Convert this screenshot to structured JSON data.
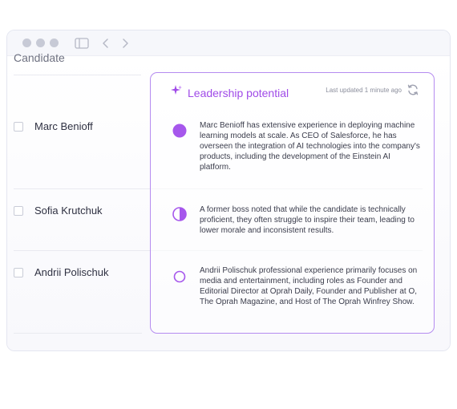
{
  "window": {
    "controls": [
      "nav-back",
      "nav-forward"
    ]
  },
  "table": {
    "column_header": "Candidate"
  },
  "panel": {
    "title": "Leadership potential",
    "updated": "Last updated 1 minute ago",
    "accent_color": "#a04be8",
    "border_color": "#b58cf0"
  },
  "candidates": [
    {
      "name": "Marc Benioff",
      "potential": "full",
      "potential_level": 1.0,
      "description": "Marc Benioff has extensive experience in deploying machine learning models at scale. As CEO of Salesforce, he has overseen the integration of AI technologies into the company's products, including the development of the Einstein AI platform."
    },
    {
      "name": "Sofia Krutchuk",
      "potential": "half",
      "potential_level": 0.5,
      "description": "A former boss noted that while the candidate is technically proficient, they often struggle to inspire their team, leading to lower morale and inconsistent results."
    },
    {
      "name": "Andrii Polischuk",
      "potential": "empty",
      "potential_level": 0.0,
      "description": "Andrii Polischuk professional experience primarily focuses on media and entertainment, including roles as Founder and Editorial Director at Oprah Daily, Founder and Publisher at O, The Oprah Magazine, and Host of The Oprah Winfrey Show."
    }
  ]
}
